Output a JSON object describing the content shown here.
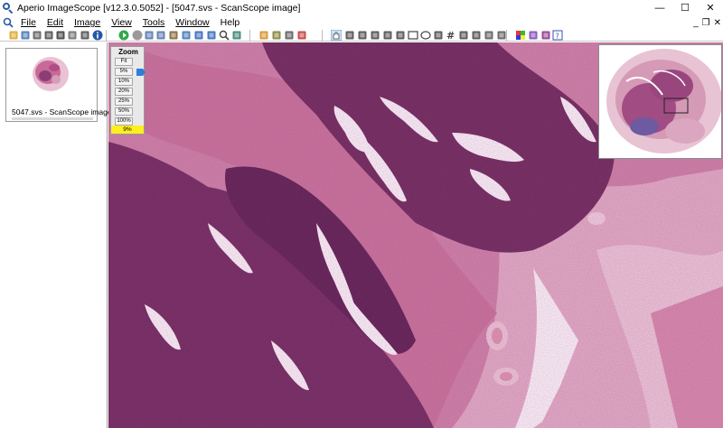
{
  "window": {
    "title": "Aperio ImageScope [v12.3.0.5052] - [5047.svs - ScanScope image]",
    "controls": {
      "minimize": "—",
      "maximize": "☐",
      "close": "✕"
    },
    "mdi_controls": {
      "minimize": "_",
      "restore": "❐",
      "close": "✕"
    }
  },
  "menu": {
    "items": [
      {
        "label": "File"
      },
      {
        "label": "Edit"
      },
      {
        "label": "Image"
      },
      {
        "label": "View"
      },
      {
        "label": "Tools"
      },
      {
        "label": "Window"
      },
      {
        "label": "Help"
      }
    ]
  },
  "toolbar": {
    "icons": [
      "open-folder-icon",
      "save-icon",
      "scanner-icon",
      "print-icon",
      "capture-icon",
      "camera-icon",
      "font-icon",
      "info-icon",
      "play-icon",
      "stop-icon",
      "network-icon",
      "network2-icon",
      "slide-icon",
      "select-region-icon",
      "overview-window-icon",
      "zoom-window-icon",
      "magnify-icon",
      "screen-icon",
      "notes-icon",
      "annotation-icon",
      "lock-icon",
      "export-icon",
      "pan-hand-icon",
      "select-arrow-icon",
      "pen-annotation-icon",
      "pen2-icon",
      "ruler-icon",
      "pen-tool-icon",
      "rectangle-icon",
      "ellipse-icon",
      "arrow-tool-icon",
      "hash-icon",
      "label-icon",
      "image-region-icon",
      "layer-icon",
      "layer2-icon",
      "color-icon",
      "lut-icon",
      "misc-icon",
      "help-icon"
    ]
  },
  "thumbnails": [
    {
      "label": "5047.svs - ScanScope image"
    }
  ],
  "zoom": {
    "title": "Zoom",
    "levels": [
      "Fit",
      "5%",
      "10%",
      "20%",
      "25%",
      "50%",
      "100%"
    ],
    "current": "9%",
    "current_fraction": 0.09
  }
}
